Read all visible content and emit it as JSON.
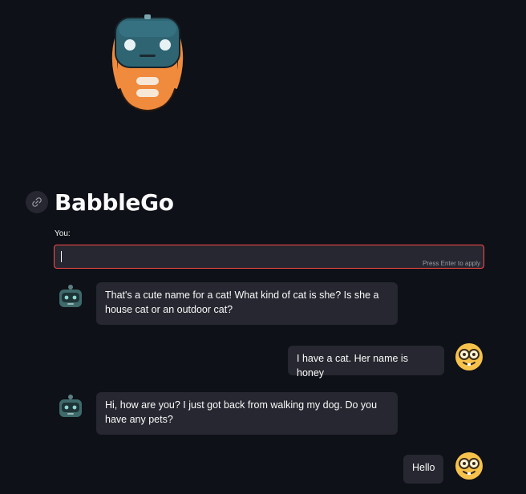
{
  "app": {
    "title": "BabbleGo"
  },
  "input": {
    "label": "You:",
    "value": "",
    "hint": "Press Enter to apply"
  },
  "messages": [
    {
      "role": "bot",
      "text": "That's a cute name for a cat! What kind of cat is she? Is she a house cat or an outdoor cat?"
    },
    {
      "role": "user",
      "text": "I have a cat. Her name is honey"
    },
    {
      "role": "bot",
      "text": "Hi, how are you? I just got back from walking my dog. Do you have any pets?"
    },
    {
      "role": "user",
      "text": "Hello"
    }
  ],
  "icons": {
    "logo": "robot-logo-icon",
    "anchor": "link-icon",
    "bot_avatar": "bot-avatar-icon",
    "user_avatar": "nerd-face-icon"
  },
  "colors": {
    "background": "#0e1117",
    "bubble": "#262730",
    "input_border": "#ff4b4b",
    "text": "#fafafa"
  }
}
